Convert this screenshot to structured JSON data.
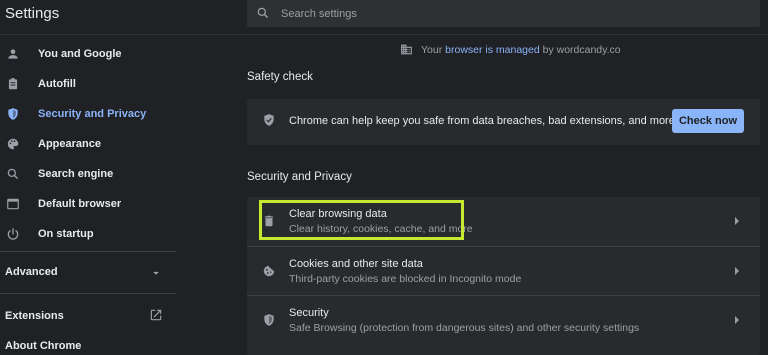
{
  "app": {
    "title": "Settings"
  },
  "search": {
    "placeholder": "Search settings"
  },
  "sidebar": {
    "items": [
      {
        "label": "You and Google",
        "icon": "person-icon"
      },
      {
        "label": "Autofill",
        "icon": "clipboard-icon"
      },
      {
        "label": "Security and Privacy",
        "icon": "shield-icon",
        "active": true
      },
      {
        "label": "Appearance",
        "icon": "palette-icon"
      },
      {
        "label": "Search engine",
        "icon": "search-icon"
      },
      {
        "label": "Default browser",
        "icon": "browser-window-icon"
      },
      {
        "label": "On startup",
        "icon": "power-icon"
      }
    ],
    "advanced": "Advanced",
    "extensions": "Extensions",
    "about": "About Chrome"
  },
  "managed": {
    "prefix": "Your ",
    "link": "browser is managed",
    "suffix": " by wordcandy.co"
  },
  "safety_check": {
    "heading": "Safety check",
    "text": "Chrome can help keep you safe from data breaches, bad extensions, and more",
    "button": "Check now"
  },
  "privacy": {
    "heading": "Security and Privacy",
    "rows": [
      {
        "title": "Clear browsing data",
        "subtitle": "Clear history, cookies, cache, and more",
        "icon": "trash-icon"
      },
      {
        "title": "Cookies and other site data",
        "subtitle": "Third-party cookies are blocked in Incognito mode",
        "icon": "cookie-icon"
      },
      {
        "title": "Security",
        "subtitle": "Safe Browsing (protection from dangerous sites) and other security settings",
        "icon": "shield-icon"
      }
    ]
  },
  "colors": {
    "accent": "#8ab4f8",
    "highlight": "#c6e82f",
    "background": "#202124",
    "card": "#292a2d"
  }
}
